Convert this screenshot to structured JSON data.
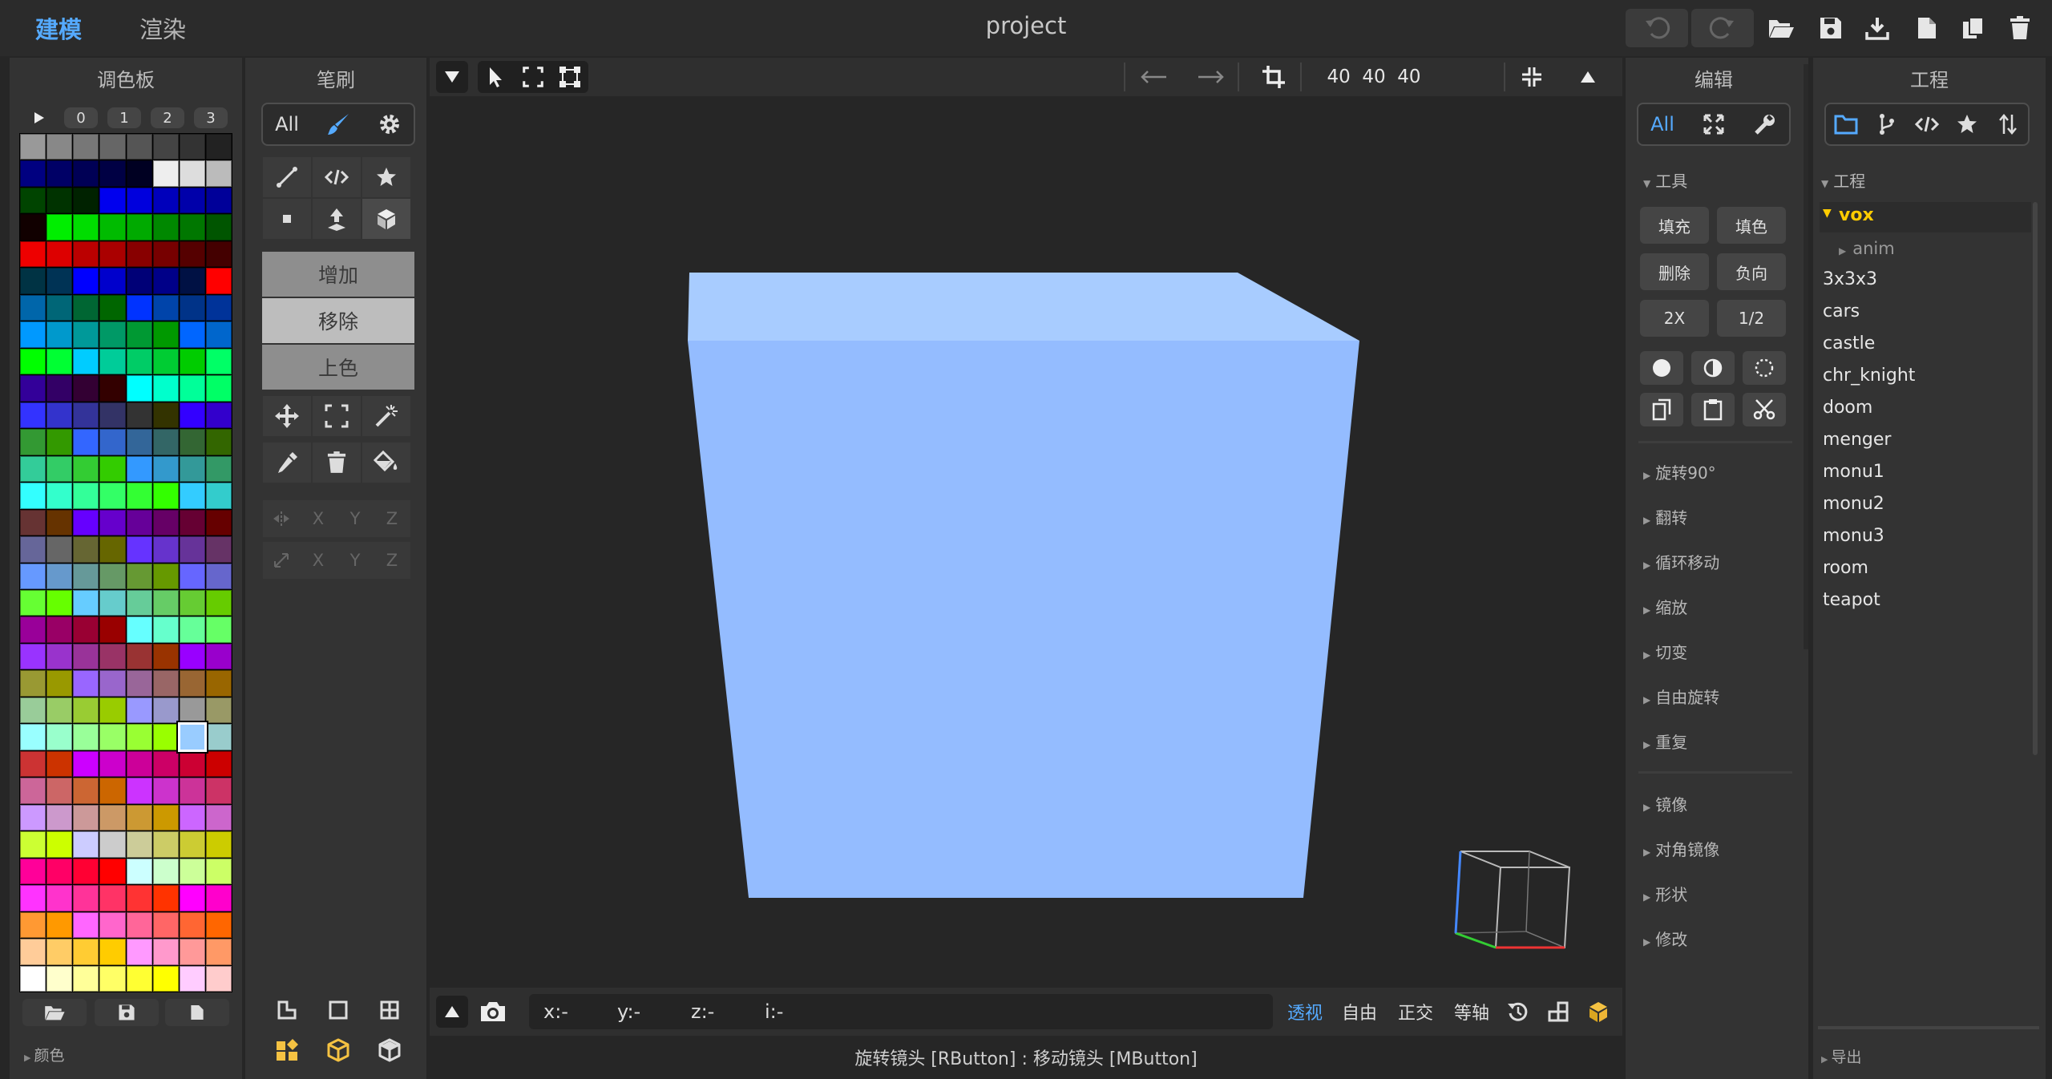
{
  "topbar": {
    "tab_model": "建模",
    "tab_render": "渲染",
    "title": "project",
    "accent": "#55aaff"
  },
  "palette": {
    "title": "调色板",
    "tabs": [
      "0",
      "1",
      "2",
      "3"
    ],
    "footer_label": "颜色",
    "colors": [
      "#999999",
      "#888888",
      "#777777",
      "#666666",
      "#555555",
      "#444444",
      "#333333",
      "#222222",
      "#000080",
      "#000066",
      "#000055",
      "#000044",
      "#000022",
      "#eeeeee",
      "#dddddd",
      "#bbbbbb",
      "#004400",
      "#003300",
      "#002200",
      "#0000ee",
      "#0000dd",
      "#0000bb",
      "#0000aa",
      "#000099",
      "#110000",
      "#00ee00",
      "#00dd00",
      "#00bb00",
      "#00aa00",
      "#008800",
      "#007700",
      "#005500",
      "#ee0000",
      "#dd0000",
      "#bb0000",
      "#aa0000",
      "#880000",
      "#770000",
      "#550000",
      "#440000",
      "#003344",
      "#003355",
      "#0000ff",
      "#0000cc",
      "#000077",
      "#000088",
      "#001144",
      "#ff0000",
      "#0066aa",
      "#006677",
      "#006633",
      "#006600",
      "#0033ff",
      "#0044aa",
      "#003388",
      "#003399",
      "#0099ff",
      "#0099cc",
      "#009999",
      "#009966",
      "#009933",
      "#009900",
      "#0066ff",
      "#0066cc",
      "#00ff00",
      "#00ff33",
      "#00ccff",
      "#00cc99",
      "#00cc66",
      "#00cc33",
      "#00cc00",
      "#00ff66",
      "#330099",
      "#330066",
      "#330033",
      "#330000",
      "#00ffff",
      "#00ffcc",
      "#00ff99",
      "#00ff66",
      "#3333ff",
      "#3333cc",
      "#333399",
      "#333366",
      "#333333",
      "#333300",
      "#3300ff",
      "#3300cc",
      "#339933",
      "#339900",
      "#3366ff",
      "#3366cc",
      "#336699",
      "#336666",
      "#336633",
      "#336600",
      "#33cc99",
      "#33cc66",
      "#33cc33",
      "#33cc00",
      "#3399ff",
      "#3399cc",
      "#339999",
      "#339966",
      "#33ffff",
      "#33ffcc",
      "#33ff99",
      "#33ff66",
      "#33ff33",
      "#33ff00",
      "#33ccff",
      "#33cccc",
      "#663333",
      "#663300",
      "#6600ff",
      "#6600cc",
      "#660099",
      "#660066",
      "#660033",
      "#660000",
      "#666699",
      "#666666",
      "#666633",
      "#666600",
      "#6633ff",
      "#6633cc",
      "#663399",
      "#663366",
      "#6699ff",
      "#6699cc",
      "#669999",
      "#669966",
      "#669933",
      "#669900",
      "#6666ff",
      "#6666cc",
      "#66ff33",
      "#66ff00",
      "#66ccff",
      "#66cccc",
      "#66cc99",
      "#66cc66",
      "#66cc33",
      "#66cc00",
      "#990099",
      "#990066",
      "#990033",
      "#990000",
      "#66ffff",
      "#66ffcc",
      "#66ff99",
      "#66ff66",
      "#9933ff",
      "#9933cc",
      "#993399",
      "#993366",
      "#993333",
      "#993300",
      "#9900ff",
      "#9900cc",
      "#999933",
      "#999900",
      "#9966ff",
      "#9966cc",
      "#996699",
      "#996666",
      "#996633",
      "#996600",
      "#99cc99",
      "#99cc66",
      "#99cc33",
      "#99cc00",
      "#9999ff",
      "#9999cc",
      "#999999",
      "#999966",
      "#99ffff",
      "#99ffcc",
      "#99ff99",
      "#99ff66",
      "#99ff33",
      "#99ff00",
      "#99ccff",
      "#99cccc",
      "#cc3333",
      "#cc3300",
      "#cc00ff",
      "#cc00cc",
      "#cc0099",
      "#cc0066",
      "#cc0033",
      "#cc0000",
      "#cc6699",
      "#cc6666",
      "#cc6633",
      "#cc6600",
      "#cc33ff",
      "#cc33cc",
      "#cc3399",
      "#cc3366",
      "#cc99ff",
      "#cc99cc",
      "#cc9999",
      "#cc9966",
      "#cc9933",
      "#cc9900",
      "#cc66ff",
      "#cc66cc",
      "#ccff33",
      "#ccff00",
      "#ccccff",
      "#cccccc",
      "#cccc99",
      "#cccc66",
      "#cccc33",
      "#cccc00",
      "#ff0099",
      "#ff0066",
      "#ff0033",
      "#ff0000",
      "#ccffff",
      "#ccffcc",
      "#ccff99",
      "#ccff66",
      "#ff33ff",
      "#ff33cc",
      "#ff3399",
      "#ff3366",
      "#ff3333",
      "#ff3300",
      "#ff00ff",
      "#ff00cc",
      "#ff9933",
      "#ff9900",
      "#ff66ff",
      "#ff66cc",
      "#ff6699",
      "#ff6666",
      "#ff6633",
      "#ff6600",
      "#ffcc99",
      "#ffcc66",
      "#ffcc33",
      "#ffcc00",
      "#ff99ff",
      "#ff99cc",
      "#ff9999",
      "#ff9966",
      "#ffffff",
      "#ffffcc",
      "#ffff99",
      "#ffff66",
      "#ffff33",
      "#ffff00",
      "#ffccff",
      "#ffcccc"
    ],
    "selected_color": "#99ccff"
  },
  "brush": {
    "title": "笔刷",
    "filter_all": "All",
    "mode_add": "增加",
    "mode_remove": "移除",
    "mode_paint": "上色",
    "axes": [
      "X",
      "Y",
      "Z"
    ]
  },
  "viewport": {
    "size": "40  40  40",
    "coord_x": "x:-",
    "coord_y": "y:-",
    "coord_z": "z:-",
    "coord_i": "i:-",
    "view_persp": "透视",
    "view_free": "自由",
    "view_ortho": "正交",
    "view_iso": "等轴",
    "status_hint": "旋转镜头 [RButton] : 移动镜头 [MButton]",
    "background": "#262626"
  },
  "edit": {
    "title": "编辑",
    "filter_all": "All",
    "tools_section": "工具",
    "buttons": [
      "填充",
      "填色",
      "删除",
      "负向",
      "2X",
      "1/2"
    ],
    "sections_a": [
      "旋转90°",
      "翻转",
      "循环移动",
      "缩放",
      "切变",
      "自由旋转",
      "重复"
    ],
    "sections_b": [
      "镜像",
      "对角镜像",
      "形状",
      "修改"
    ]
  },
  "project": {
    "title": "工程",
    "section": "工程",
    "folder": "vox",
    "subfolder": "anim",
    "items": [
      "3x3x3",
      "cars",
      "castle",
      "chr_knight",
      "doom",
      "menger",
      "monu1",
      "monu2",
      "monu3",
      "room",
      "teapot"
    ],
    "footer_label": "导出",
    "folder_color": "#ffcc00"
  }
}
